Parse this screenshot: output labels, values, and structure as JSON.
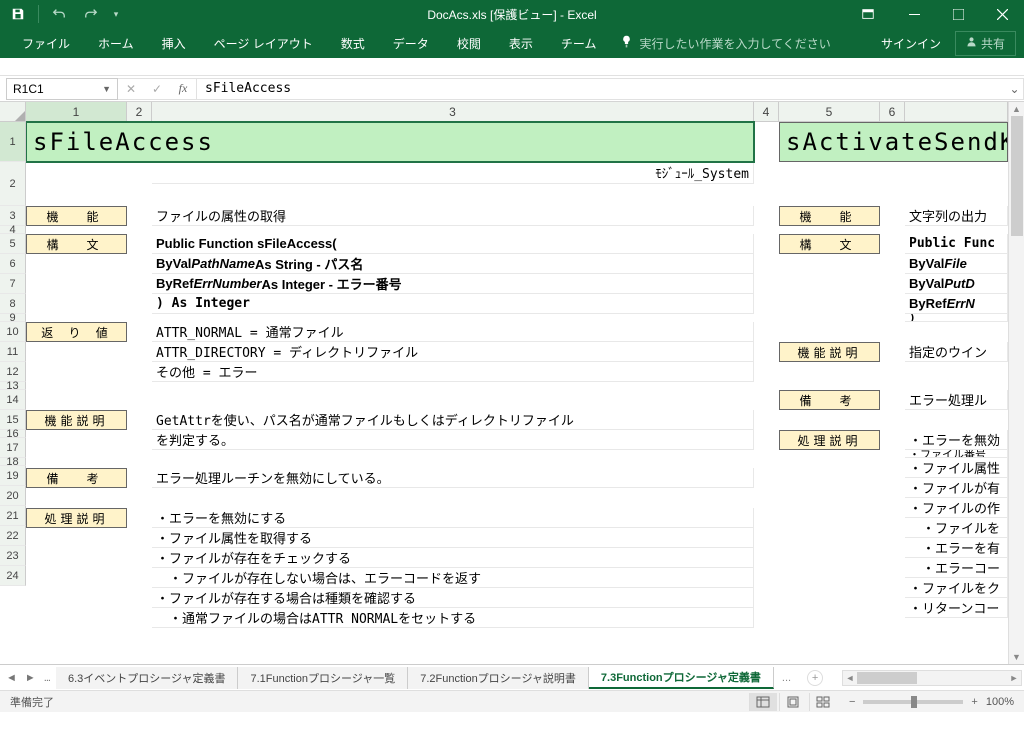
{
  "title": "DocAcs.xls [保護ビュー] - Excel",
  "qat": {
    "save": "save",
    "undo": "undo",
    "redo": "redo"
  },
  "ribbon": {
    "tabs": [
      "ファイル",
      "ホーム",
      "挿入",
      "ページ レイアウト",
      "数式",
      "データ",
      "校閲",
      "表示",
      "チーム"
    ],
    "tellme": "実行したい作業を入力してください",
    "signin": "サインイン",
    "share": "共有"
  },
  "namebox": "R1C1",
  "formula": "sFileAccess",
  "cols": {
    "c1": "1",
    "c2": "2",
    "c3": "3",
    "c4": "4",
    "c5": "5",
    "c6": "6"
  },
  "rows": [
    "1",
    "2",
    "3",
    "4",
    "5",
    "6",
    "7",
    "8",
    "9",
    "10",
    "11",
    "12",
    "13",
    "14",
    "15",
    "16",
    "17",
    "18",
    "19",
    "20",
    "21",
    "22",
    "23",
    "24"
  ],
  "cells": {
    "A1": "sFileAccess",
    "C1mod": "ﾓｼﾞｭｰﾙ_System",
    "E1": "sActivateSendK",
    "A3": "機　能",
    "C3": "ファイルの属性の取得",
    "E3": "機　能",
    "G3": "文字列の出力",
    "A5": "構　文",
    "C5a": "Public Function sFileAccess(",
    "C6a": "  ByVal ",
    "C6b": "PathName",
    "C6c": "   As String  - パス名",
    "C7a": "  ByRef ",
    "C7b": "ErrNumber",
    "C7c": "  As Integer - エラー番号",
    "C8": ") As Integer",
    "E5": "構　文",
    "G5": "Public Func",
    "G6a": "  ByVal ",
    "G6b": "File",
    "G7a": "  ByVal ",
    "G7b": "PutD",
    "G8a": "  ByRef ",
    "G8b": "ErrN",
    "G9": ")",
    "A10": "返 り 値",
    "C10": "ATTR_NORMAL    = 通常ファイル",
    "C11": "ATTR_DIRECTORY = ディレクトリファイル",
    "C12": "その他         = エラー",
    "E10": "機能説明",
    "G10": "指定のウイン",
    "E12": "備　考",
    "G12": "エラー処理ル",
    "A14": "機能説明",
    "C14": "GetAttrを使い、パス名が通常ファイルもしくはディレクトリファイル",
    "C15": "を判定する。",
    "E14": "処理説明",
    "G14": "・エラーを無効",
    "G15": "・ファイル番号",
    "G16": "・ファイル属性",
    "A17": "備　考",
    "C17": "エラー処理ルーチンを無効にしている。",
    "G17": "・ファイルが有",
    "G18": "・ファイルの作",
    "A19": "処理説明",
    "C19": "・エラーを無効にする",
    "G19": "　・ファイルを",
    "C20": "・ファイル属性を取得する",
    "G20": "　・エラーを有",
    "C21": "・ファイルが存在をチェックする",
    "G21": "　・エラーコー",
    "C22": "　・ファイルが存在しない場合は、エラーコードを返す",
    "G22": "・ファイルをク",
    "C23": "・ファイルが存在する場合は種類を確認する",
    "G23": "・リターンコー",
    "C24": "　・通常ファイルの場合はATTR NORMALをセットする"
  },
  "sheet_tabs": {
    "nav_dots": "...",
    "tabs": [
      {
        "label": "6.3イベントプロシージャ定義書",
        "active": false
      },
      {
        "label": "7.1Functionプロシージャ一覧",
        "active": false
      },
      {
        "label": "7.2Functionプロシージャ説明書",
        "active": false
      },
      {
        "label": "7.3Functionプロシージャ定義書",
        "active": true
      }
    ],
    "more": "..."
  },
  "status": {
    "ready": "準備完了",
    "zoom": "100%"
  }
}
